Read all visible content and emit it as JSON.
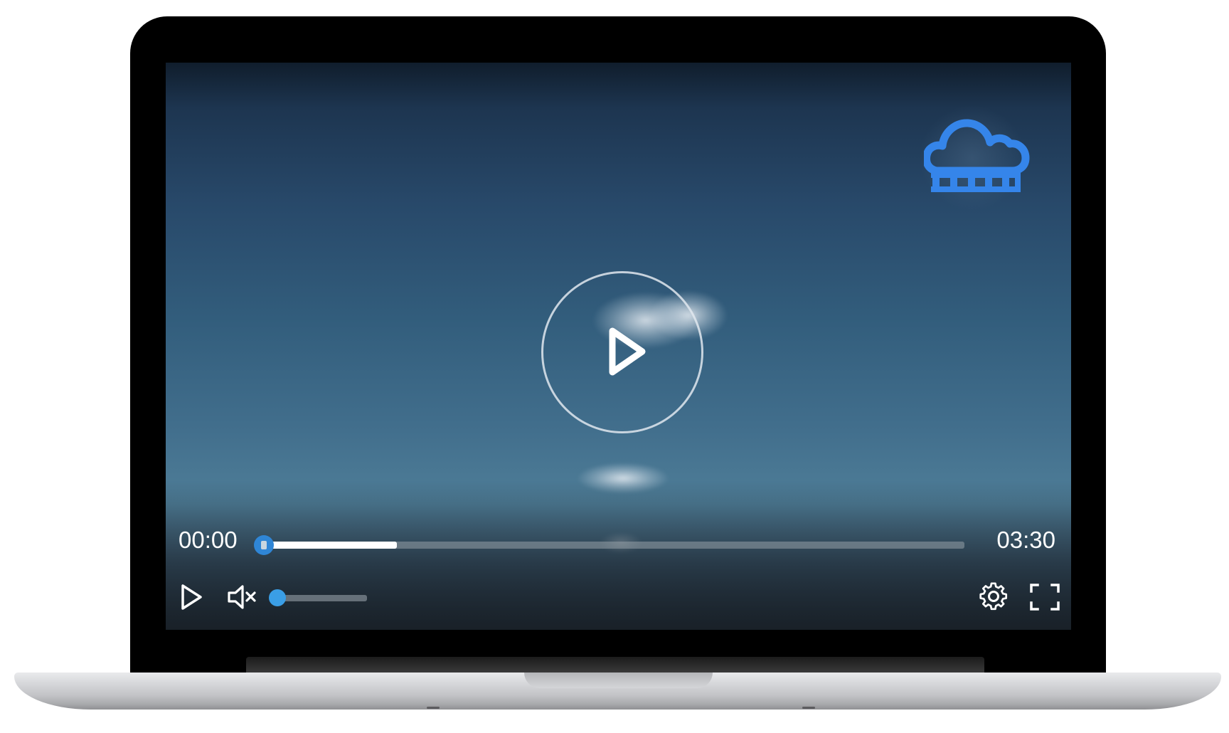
{
  "player": {
    "time_current": "00:00",
    "time_total": "03:30",
    "progress_fraction": 0,
    "buffered_fraction": 0.19,
    "volume_fraction": 0.0,
    "muted": true,
    "accent_color": "#2f86d6",
    "logo": "cloud-rain-logo-icon",
    "controls": {
      "play": "play-icon",
      "mute": "volume-muted-icon",
      "settings": "gear-icon",
      "fullscreen": "fullscreen-icon",
      "big_play": "play-circle-icon"
    }
  }
}
